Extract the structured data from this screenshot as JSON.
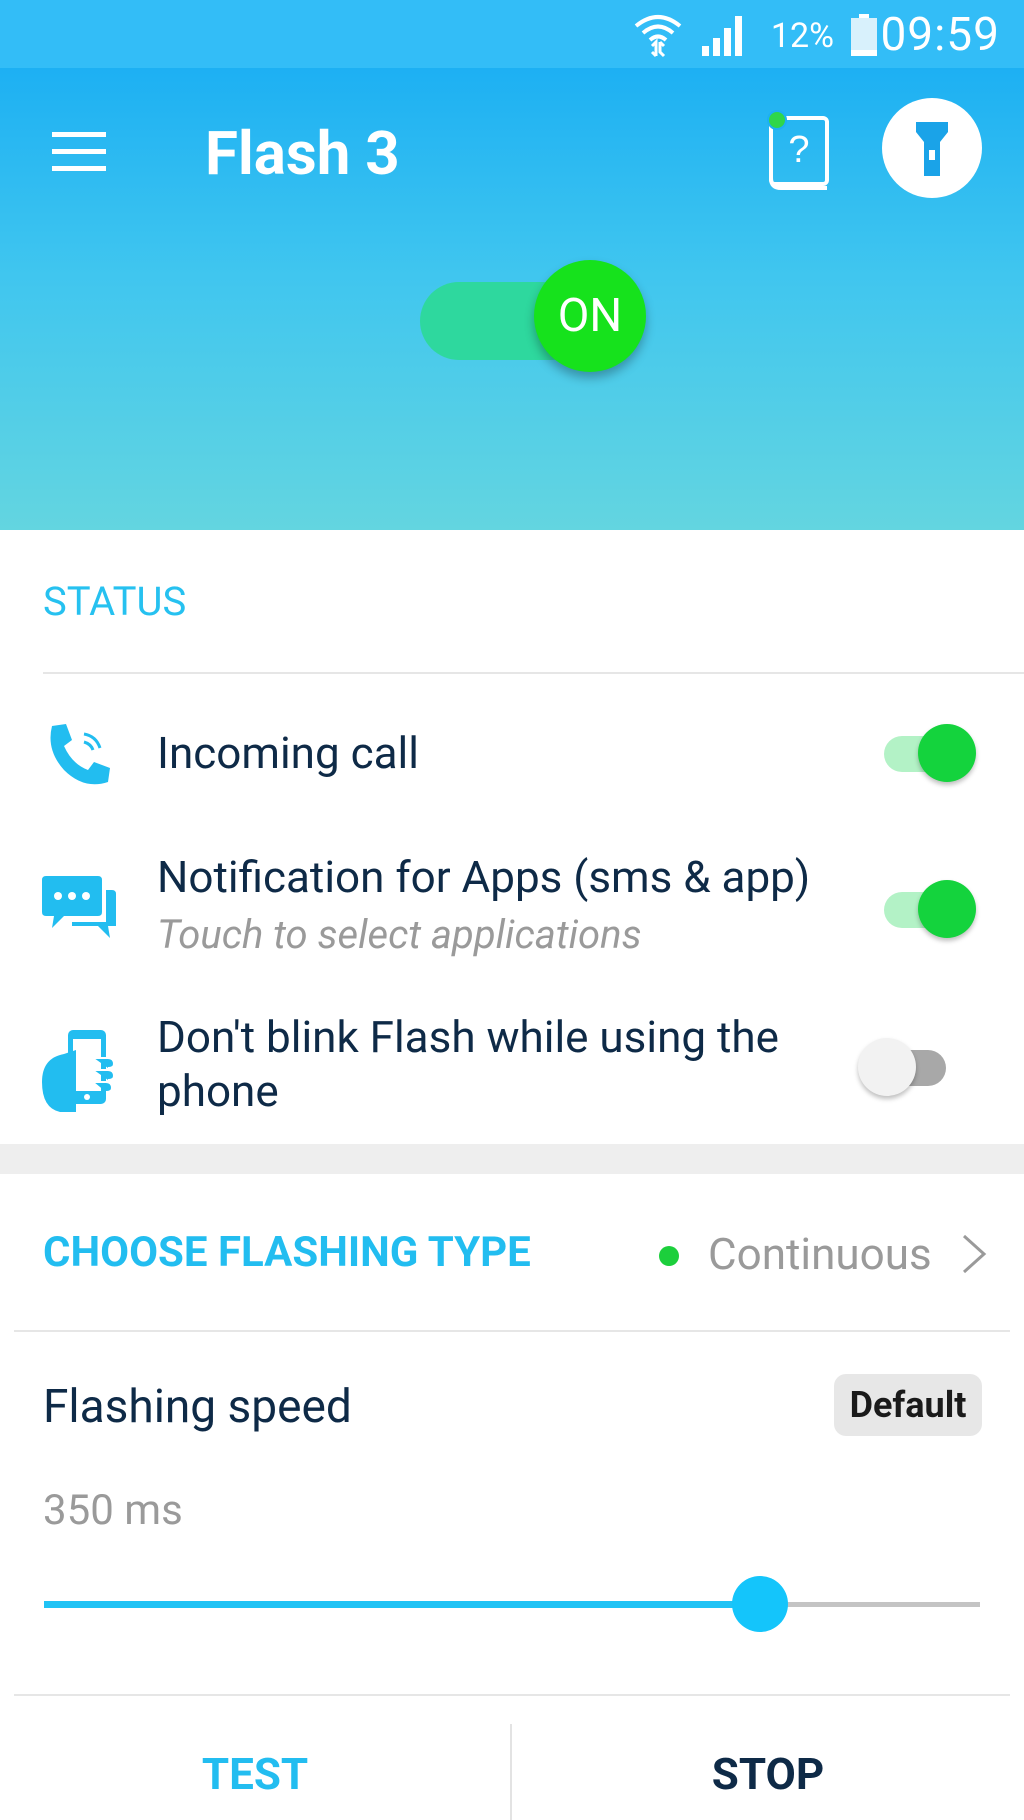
{
  "status_bar": {
    "time": "09:59",
    "battery_percent": "12%",
    "icons": [
      "wifi-icon",
      "signal-icon",
      "battery-icon"
    ]
  },
  "header": {
    "title": "Flash 3",
    "main_switch_label": "ON",
    "icons": [
      "menu-icon",
      "help-book-icon",
      "flashlight-icon"
    ]
  },
  "status": {
    "section_title": "STATUS",
    "items": [
      {
        "icon": "phone-icon",
        "label": "Incoming call",
        "enabled": true
      },
      {
        "icon": "chat-icon",
        "label": "Notification for Apps (sms & app)",
        "sublabel": "Touch to select applications",
        "enabled": true
      },
      {
        "icon": "hand-phone-icon",
        "label": "Don't blink Flash while using the phone",
        "enabled": false
      }
    ]
  },
  "flashing": {
    "choose_title": "CHOOSE FLASHING TYPE",
    "type_value": "Continuous",
    "speed_label": "Flashing speed",
    "default_button": "Default",
    "speed_value": "350 ms",
    "slider_fraction": 0.765
  },
  "actions": {
    "test": "TEST",
    "stop": "STOP"
  },
  "colors": {
    "accent": "#22bdf0",
    "switch_on": "#14d33d",
    "header_top": "#1db0f3",
    "header_bottom": "#63d5e0"
  }
}
